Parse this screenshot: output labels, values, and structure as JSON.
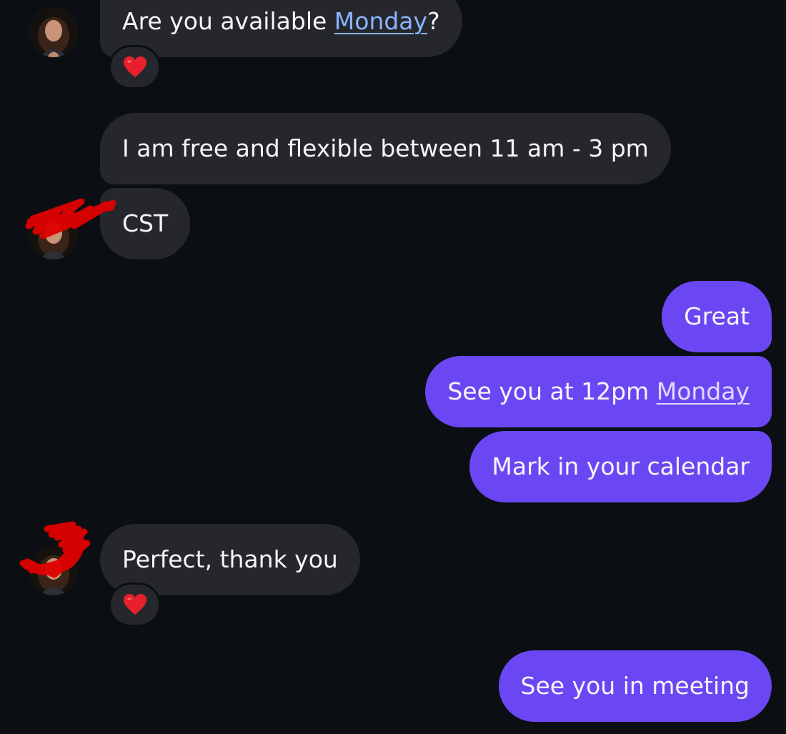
{
  "conversation": {
    "messages": [
      {
        "from": "contact",
        "text_before": "Are you available ",
        "link": "Monday",
        "text_after": "?",
        "reaction": "❤️"
      },
      {
        "from": "contact",
        "text": "I am free and flexible between 11 am - 3 pm"
      },
      {
        "from": "contact",
        "text": "CST"
      },
      {
        "from": "me",
        "text": "Great"
      },
      {
        "from": "me",
        "text_before": "See you at 12pm ",
        "link": "Monday"
      },
      {
        "from": "me",
        "text": "Mark in your calendar"
      },
      {
        "from": "contact",
        "text": "Perfect, thank you",
        "reaction": "❤️"
      },
      {
        "from": "me",
        "text": "See you in meeting"
      }
    ]
  },
  "colors": {
    "background": "#0b0f13",
    "incoming_bubble": "#25272c",
    "outgoing_bubble": "#6b47f4",
    "incoming_link": "#8ab4ff",
    "outgoing_link": "#e3d9ff",
    "reaction_heart": "#e8202e",
    "redaction": "#e00000"
  },
  "icons": {
    "reaction": "heart-icon",
    "avatar": "contact-avatar",
    "redaction": "red-scribble"
  }
}
